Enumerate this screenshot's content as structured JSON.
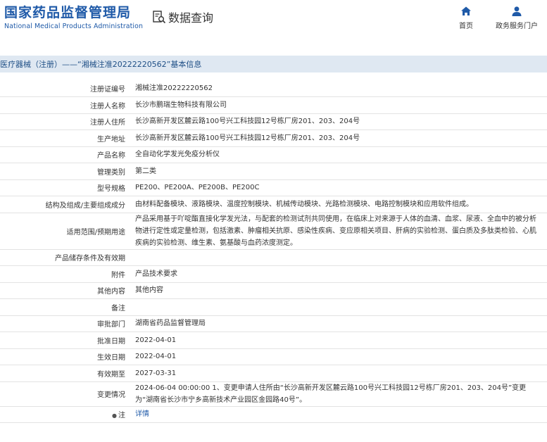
{
  "header": {
    "logo_cn": "国家药品监督管理局",
    "logo_en": "National Medical Products Administration",
    "query_label": "数据查询",
    "nav": [
      {
        "label": "首页",
        "icon": "home-icon"
      },
      {
        "label": "政务服务门户",
        "icon": "user-icon"
      }
    ]
  },
  "breadcrumb": "医疗器械（注册）——“湘械注准20222220562”基本信息",
  "colors": {
    "brand": "#1f5aa8",
    "crumb_bg": "#dfe8f2",
    "row_border": "#e3e3e3"
  },
  "rows": [
    {
      "label": "注册证编号",
      "value": "湘械注准20222220562"
    },
    {
      "label": "注册人名称",
      "value": "长沙市鹏瑞生物科技有限公司"
    },
    {
      "label": "注册人住所",
      "value": "长沙高新开发区麓云路100号兴工科技园12号栋厂房201、203、204号"
    },
    {
      "label": "生产地址",
      "value": "长沙高新开发区麓云路100号兴工科技园12号栋厂房201、203、204号"
    },
    {
      "label": "产品名称",
      "value": "全自动化学发光免疫分析仪"
    },
    {
      "label": "管理类别",
      "value": "第二类"
    },
    {
      "label": "型号规格",
      "value": "PE200、PE200A、PE200B、PE200C"
    },
    {
      "label": "结构及组成/主要组成成分",
      "value": "由材料配备模块、液路模块、温度控制模块、机械传动模块、光路检测模块、电路控制模块和应用软件组成。"
    },
    {
      "label": "适用范围/预期用途",
      "value": "产品采用基于吖啶酯直接化学发光法，与配套的检测试剂共同使用，在临床上对来源于人体的血清、血浆、尿液、全血中的被分析物进行定性或定量检测，包括激素、肿瘤相关抗原、感染性疾病、变应原相关项目、肝病的实验检测、蛋白质及多肽类检验、心肌疾病的实验检测、维生素、氨基酸与血药浓度测定。"
    },
    {
      "label": "产品储存条件及有效期",
      "value": ""
    },
    {
      "label": "附件",
      "value": "产品技术要求"
    },
    {
      "label": "其他内容",
      "value": "其他内容"
    },
    {
      "label": "备注",
      "value": ""
    },
    {
      "label": "审批部门",
      "value": "湖南省药品监督管理局"
    },
    {
      "label": "批准日期",
      "value": "2022-04-01"
    },
    {
      "label": "生效日期",
      "value": "2022-04-01"
    },
    {
      "label": "有效期至",
      "value": "2027-03-31"
    },
    {
      "label": "变更情况",
      "value": "2024-06-04 00:00:00 1、变更申请人住所由“长沙高新开发区麓云路100号兴工科技园12号栋厂房201、203、204号”变更为“湖南省长沙市宁乡高新技术产业园区金园路40号”。"
    },
    {
      "label": "注",
      "value": "详情",
      "icon": "pin-icon"
    }
  ]
}
